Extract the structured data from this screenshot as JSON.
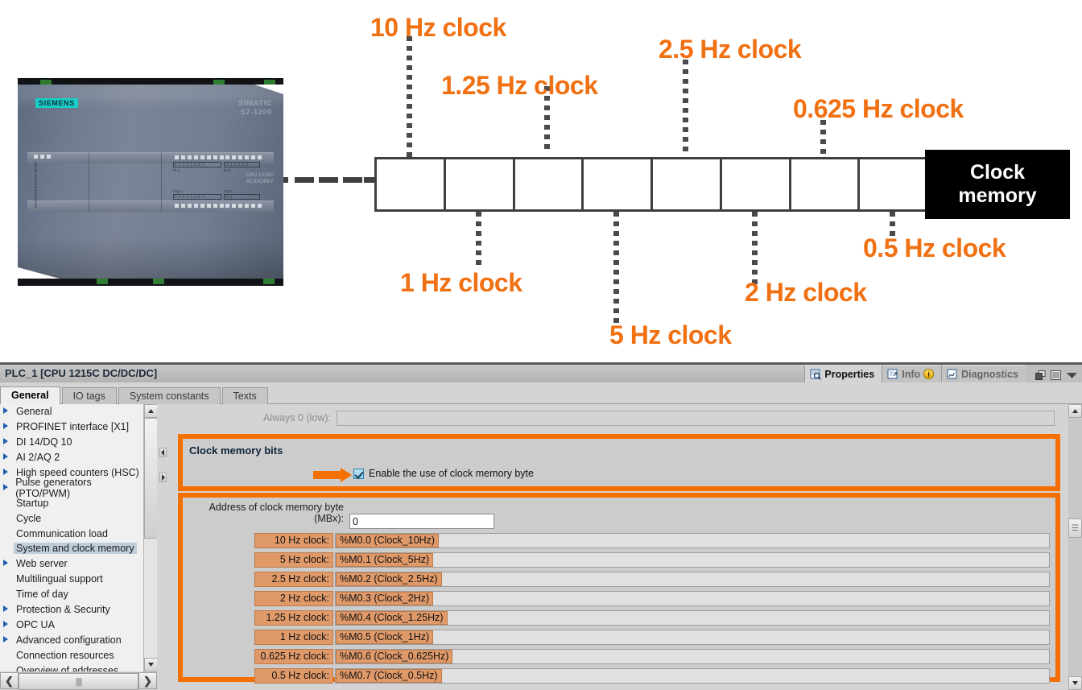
{
  "diagram": {
    "device": {
      "brand": "SIEMENS",
      "family": "SIMATIC",
      "series": "S7-1200",
      "cpu": "CPU 1215C",
      "cpu_sub": "AC/DC/RLY",
      "led_labels": "RUN/STOP\nERROR\nMAINT",
      "inputs_label": "DI a",
      "inputs_label_b": "DI b",
      "outputs_label": "DQ a",
      "outputs_label_b": "DQ b",
      "in_bits_a": "0 .1 .2 .3 .4 .5 .6 .7",
      "in_bits_b": ".0 .1 .2 .3 .4 .5",
      "out_bits_a": "0 .1 .2 .3 .4 .5 .6 .7",
      "out_bits_b": ".0 .1"
    },
    "byte_box_label": "Clock\nmemory",
    "byte_cells": 8,
    "labels_top": [
      {
        "text": "10 Hz clock",
        "bit": 0
      },
      {
        "text": "1.25 Hz clock",
        "bit": 2
      },
      {
        "text": "2.5 Hz clock",
        "bit": 4
      },
      {
        "text": "0.625 Hz clock",
        "bit": 6
      }
    ],
    "labels_bottom": [
      {
        "text": "1 Hz clock",
        "bit": 1
      },
      {
        "text": "5 Hz clock",
        "bit": 3
      },
      {
        "text": "2 Hz clock",
        "bit": 5
      },
      {
        "text": "0.5 Hz clock",
        "bit": 7
      }
    ],
    "accent_color": "#f07012"
  },
  "panel": {
    "title": "PLC_1 [CPU 1215C DC/DC/DC]",
    "view_tabs": [
      {
        "label": "Properties",
        "icon": "properties-icon",
        "active": true
      },
      {
        "label": "Info",
        "icon": "info-icon",
        "active": false,
        "badge": "i"
      },
      {
        "label": "Diagnostics",
        "icon": "diagnostics-icon",
        "active": false
      }
    ],
    "window_icons": [
      "restore-icon",
      "list-icon",
      "chevron-down-icon"
    ],
    "main_tabs": [
      {
        "label": "General",
        "active": true
      },
      {
        "label": "IO tags",
        "active": false
      },
      {
        "label": "System constants",
        "active": false
      },
      {
        "label": "Texts",
        "active": false
      }
    ],
    "tree": [
      {
        "label": "General",
        "expandable": true,
        "selected": false
      },
      {
        "label": "PROFINET interface [X1]",
        "expandable": true,
        "selected": false
      },
      {
        "label": "DI 14/DQ 10",
        "expandable": true,
        "selected": false
      },
      {
        "label": "AI 2/AQ 2",
        "expandable": true,
        "selected": false
      },
      {
        "label": "High speed counters (HSC)",
        "expandable": true,
        "selected": false
      },
      {
        "label": "Pulse generators (PTO/PWM)",
        "expandable": true,
        "selected": false
      },
      {
        "label": "Startup",
        "expandable": false,
        "selected": false
      },
      {
        "label": "Cycle",
        "expandable": false,
        "selected": false
      },
      {
        "label": "Communication load",
        "expandable": false,
        "selected": false
      },
      {
        "label": "System and clock memory",
        "expandable": false,
        "selected": true
      },
      {
        "label": "Web server",
        "expandable": true,
        "selected": false
      },
      {
        "label": "Multilingual support",
        "expandable": false,
        "selected": false
      },
      {
        "label": "Time of day",
        "expandable": false,
        "selected": false
      },
      {
        "label": "Protection & Security",
        "expandable": true,
        "selected": false
      },
      {
        "label": "OPC UA",
        "expandable": true,
        "selected": false
      },
      {
        "label": "Advanced configuration",
        "expandable": true,
        "selected": false
      },
      {
        "label": "Connection resources",
        "expandable": false,
        "selected": false
      },
      {
        "label": "Overview of addresses",
        "expandable": false,
        "selected": false
      }
    ],
    "hscroll": {
      "left_arrow": "❮",
      "right_arrow": "❯",
      "grip": "||||"
    },
    "vscroll": {
      "up_arrow": "∧",
      "down_arrow": "∨"
    },
    "always_low": {
      "label": "Always 0 (low):",
      "value": ""
    },
    "clock_section": {
      "title": "Clock memory bits",
      "enable_label": "Enable the use of clock memory byte",
      "enable_checked": true,
      "address_label_line1": "Address of clock memory byte",
      "address_label_line2": "(MBx):",
      "address_value": "0",
      "bits": [
        {
          "name": "10 Hz clock:",
          "value": "%M0.0 (Clock_10Hz)"
        },
        {
          "name": "5 Hz clock:",
          "value": "%M0.1 (Clock_5Hz)"
        },
        {
          "name": "2.5 Hz clock:",
          "value": "%M0.2 (Clock_2.5Hz)"
        },
        {
          "name": "2 Hz clock:",
          "value": "%M0.3 (Clock_2Hz)"
        },
        {
          "name": "1.25 Hz clock:",
          "value": "%M0.4 (Clock_1.25Hz)"
        },
        {
          "name": "1 Hz clock:",
          "value": "%M0.5 (Clock_1Hz)"
        },
        {
          "name": "0.625 Hz clock:",
          "value": "%M0.6 (Clock_0.625Hz)"
        },
        {
          "name": "0.5 Hz clock:",
          "value": "%M0.7 (Clock_0.5Hz)"
        }
      ]
    },
    "highlight_color": "#f57000"
  }
}
